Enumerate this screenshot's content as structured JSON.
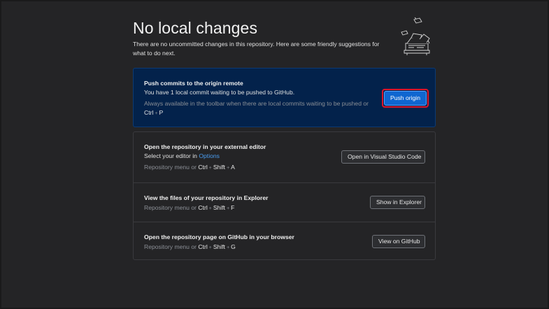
{
  "page": {
    "title": "No local changes",
    "subtitle": "There are no uncommitted changes in this repository. Here are some friendly suggestions for what to do next."
  },
  "push_card": {
    "title": "Push commits to the origin remote",
    "description": "You have 1 local commit waiting to be pushed to GitHub.",
    "hint": "Always available in the toolbar when there are local commits waiting to be pushed or",
    "shortcut": [
      "Ctrl",
      "P"
    ],
    "button_label": "Push origin"
  },
  "editor_row": {
    "title": "Open the repository in your external editor",
    "description_prefix": "Select your editor in ",
    "options_link": "Options",
    "hint_prefix": "Repository menu or",
    "shortcut": [
      "Ctrl",
      "Shift",
      "A"
    ],
    "button_label": "Open in Visual Studio Code"
  },
  "explorer_row": {
    "title": "View the files of your repository in Explorer",
    "hint_prefix": "Repository menu or",
    "shortcut": [
      "Ctrl",
      "Shift",
      "F"
    ],
    "button_label": "Show in Explorer"
  },
  "github_row": {
    "title": "Open the repository page on GitHub in your browser",
    "hint_prefix": "Repository menu or",
    "shortcut": [
      "Ctrl",
      "Shift",
      "G"
    ],
    "button_label": "View on GitHub"
  },
  "plus_sign": "+",
  "icons": {
    "illustration": "paper-stack-illustration"
  },
  "colors": {
    "background": "#242426",
    "push_card_bg": "#03224b",
    "primary_button": "#0f66d0",
    "link": "#4a9df0",
    "highlight": "#e0162b"
  }
}
